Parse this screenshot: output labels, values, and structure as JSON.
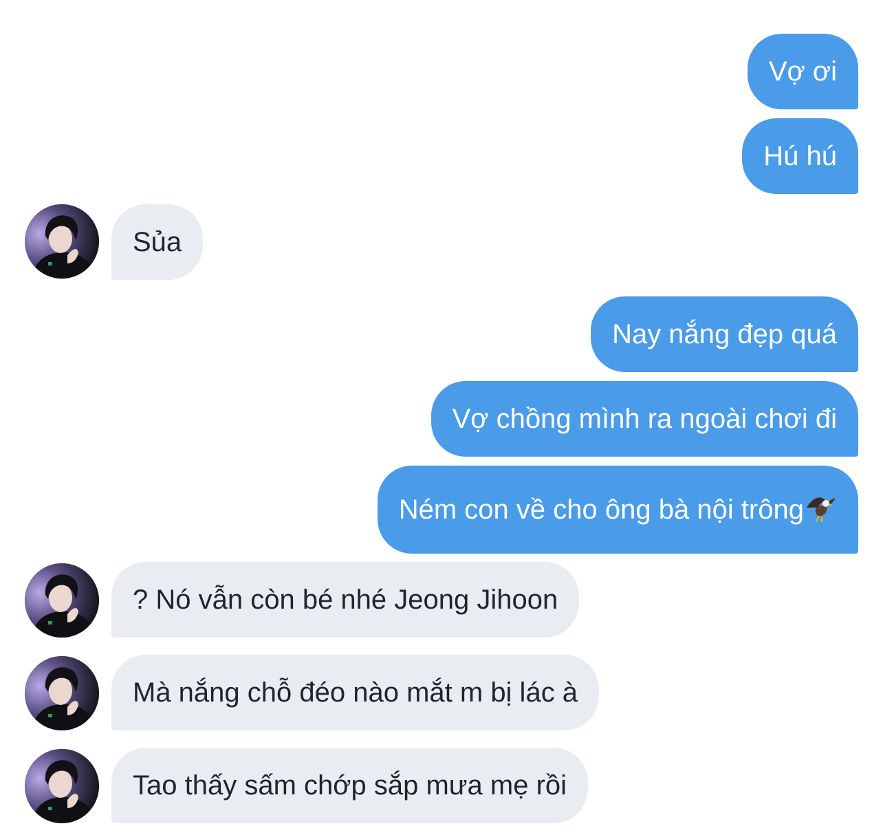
{
  "conversation": {
    "messages": [
      {
        "side": "sent",
        "text": "Vợ ơi"
      },
      {
        "side": "sent",
        "text": "Hú hú"
      },
      {
        "side": "received",
        "text": "Sủa"
      },
      {
        "side": "sent",
        "text": "Nay nắng đẹp quá"
      },
      {
        "side": "sent",
        "text": "Vợ chồng mình ra ngoài chơi đi"
      },
      {
        "side": "sent",
        "text": "Ném con về cho ông bà nội trông",
        "emoji": "eagle-emoji"
      },
      {
        "side": "received",
        "text": "? Nó vẫn còn bé nhé Jeong Jihoon"
      },
      {
        "side": "received",
        "text": "Mà nắng chỗ đéo nào mắt m bị lác à"
      },
      {
        "side": "received",
        "text": "Tao thấy sấm chớp sắp mưa mẹ rồi"
      }
    ]
  },
  "colors": {
    "sent_bubble": "#4a9be8",
    "received_bubble": "#e9edf1",
    "received_text": "#1e2430",
    "background": "#ffffff"
  }
}
